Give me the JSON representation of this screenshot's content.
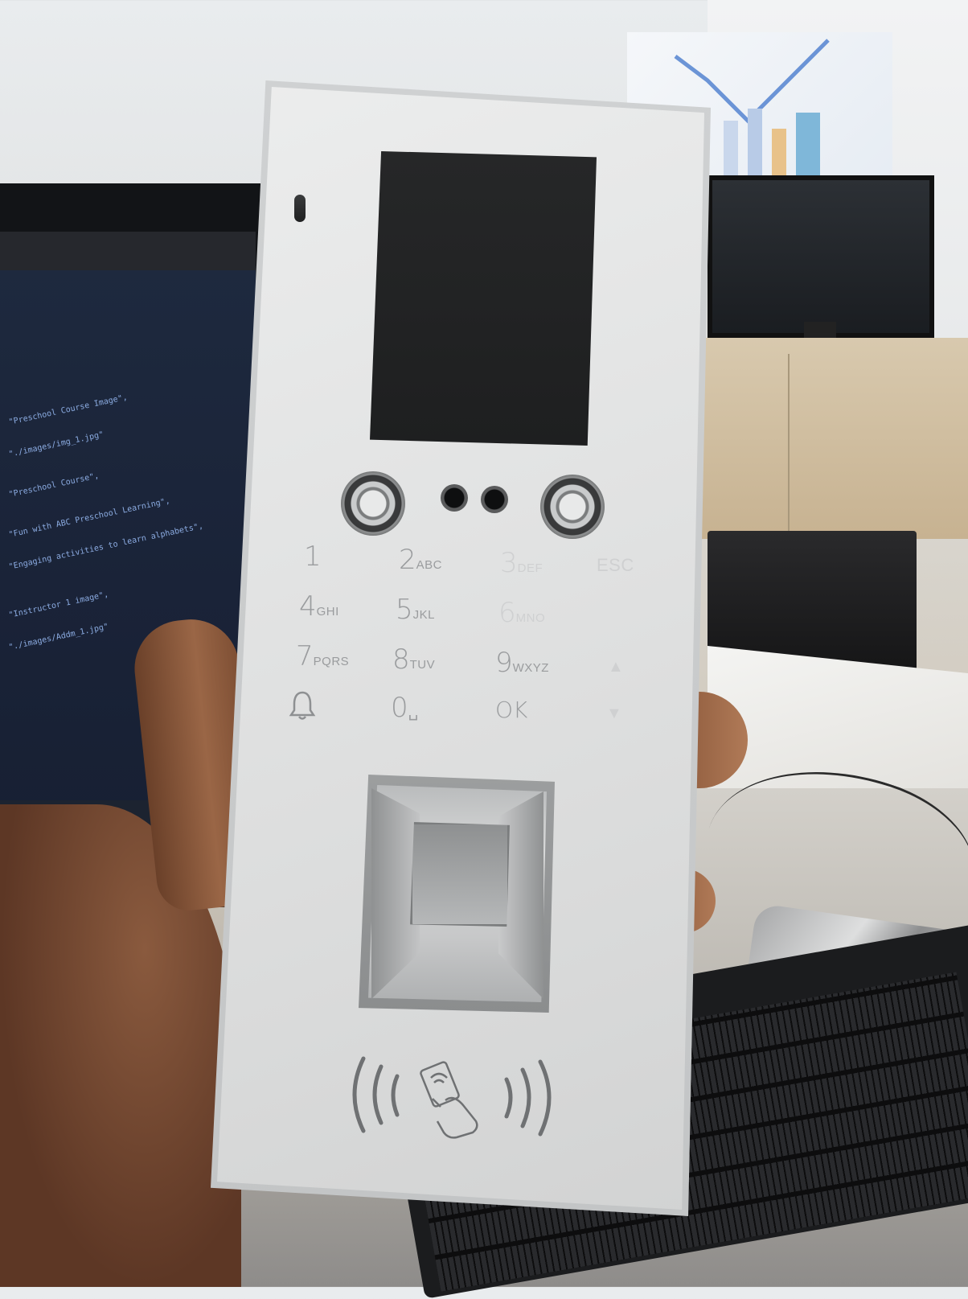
{
  "keypad": {
    "rows": [
      [
        {
          "num": "1",
          "sub": ""
        },
        {
          "num": "2",
          "sub": "ABC"
        },
        {
          "num": "3",
          "sub": "DEF"
        },
        {
          "num": "ESC",
          "sub": ""
        }
      ],
      [
        {
          "num": "4",
          "sub": "GHI"
        },
        {
          "num": "5",
          "sub": "JKL"
        },
        {
          "num": "6",
          "sub": "MNO"
        }
      ],
      [
        {
          "num": "7",
          "sub": "PQRS"
        },
        {
          "num": "8",
          "sub": "TUV"
        },
        {
          "num": "9",
          "sub": "WXYZ"
        }
      ],
      [
        {
          "num": "0",
          "sub": "␣"
        },
        {
          "num": "OK",
          "sub": ""
        }
      ]
    ],
    "arrows": {
      "up": "▲",
      "down": "▼"
    }
  },
  "icons": {
    "bell": "bell-icon",
    "rfid": "contactless-card-icon"
  },
  "colors": {
    "panel": "#e4e5e5",
    "screen": "#232425",
    "key_text": "#9a9c9e",
    "skin": "#8a5a3e"
  }
}
